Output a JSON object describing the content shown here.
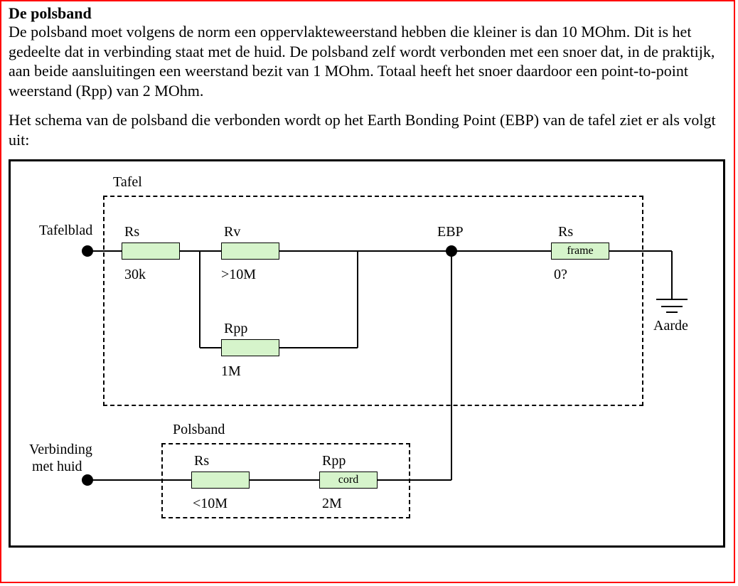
{
  "title": "De polsband",
  "paragraph1": "De polsband moet volgens de norm een oppervlakteweerstand hebben die kleiner is dan 10 MOhm. Dit is het gedeelte dat in verbinding staat met de huid. De polsband zelf wordt verbonden met een snoer dat, in de praktijk, aan beide aansluitingen een weerstand bezit van 1 MOhm. Totaal heeft het snoer daardoor een point-to-point weerstand (Rpp) van 2 MOhm.",
  "paragraph2": "Het schema van de polsband die verbonden wordt op het Earth Bonding Point (EBP) van de tafel ziet er als volgt uit:",
  "diagram": {
    "tafel_label": "Tafel",
    "tafelblad_label": "Tafelblad",
    "polsband_label": "Polsband",
    "verbinding_line1": "Verbinding",
    "verbinding_line2": "met  huid",
    "ebp_label": "EBP",
    "aarde_label": "Aarde",
    "tafel": {
      "rs_label": "Rs",
      "rs_value": "30k",
      "rv_label": "Rv",
      "rv_value": ">10M",
      "rpp_label": "Rpp",
      "rpp_value": "1M"
    },
    "frame": {
      "rs_label": "Rs",
      "box_text": "frame",
      "value": "0?"
    },
    "polsband": {
      "rs_label": "Rs",
      "rs_value": "<10M",
      "rpp_label": "Rpp",
      "rpp_box_text": "cord",
      "rpp_value": "2M"
    }
  }
}
